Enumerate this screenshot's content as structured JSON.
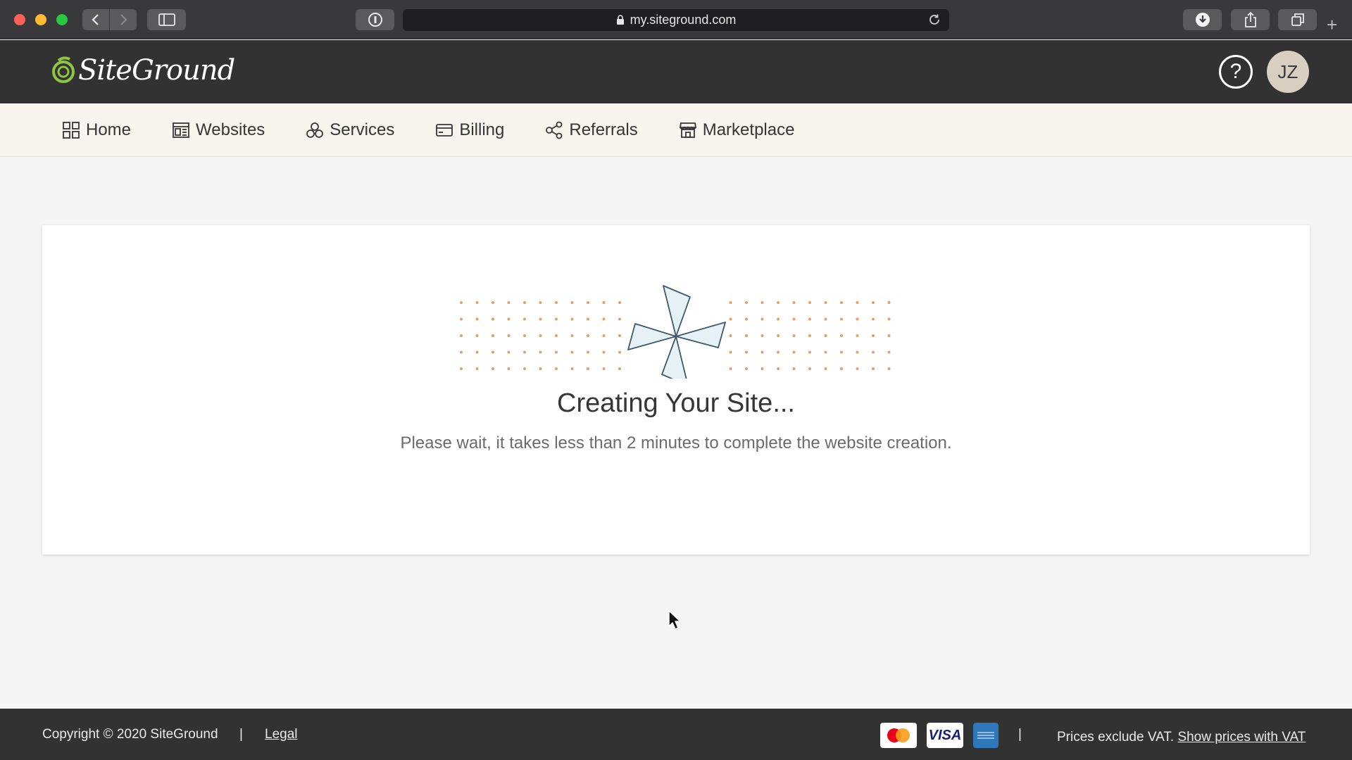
{
  "browser": {
    "url": "my.siteground.com",
    "icons": {
      "back": "chevron-left-icon",
      "forward": "chevron-right-icon",
      "sidebar": "sidebar-icon",
      "password": "password-manager-icon",
      "reload": "reload-icon",
      "download": "download-icon",
      "share": "share-icon",
      "tabs": "tabs-icon",
      "new_tab": "+"
    }
  },
  "header": {
    "logo_text": "SiteGround",
    "help_label": "?",
    "avatar_initials": "JZ"
  },
  "nav": {
    "items": [
      {
        "label": "Home",
        "icon": "grid-icon"
      },
      {
        "label": "Websites",
        "icon": "website-icon"
      },
      {
        "label": "Services",
        "icon": "services-icon"
      },
      {
        "label": "Billing",
        "icon": "credit-card-icon"
      },
      {
        "label": "Referrals",
        "icon": "share-nodes-icon"
      },
      {
        "label": "Marketplace",
        "icon": "store-icon"
      }
    ]
  },
  "main": {
    "title": "Creating Your Site...",
    "message": "Please wait, it takes less than 2 minutes to complete the website creation."
  },
  "footer": {
    "copyright": "Copyright © 2020 SiteGround",
    "separator": "|",
    "legal": "Legal",
    "payment_cards": [
      "mastercard",
      "VISA",
      "american express"
    ],
    "prices_note": "Prices exclude VAT.",
    "show_vat_link": "Show prices with VAT"
  },
  "colors": {
    "header_bg": "#333232",
    "nav_bg": "#f8f4ee",
    "page_bg": "#f5f5f5",
    "logo_accent": "#8dc63f",
    "dots": "#e0a06f"
  }
}
